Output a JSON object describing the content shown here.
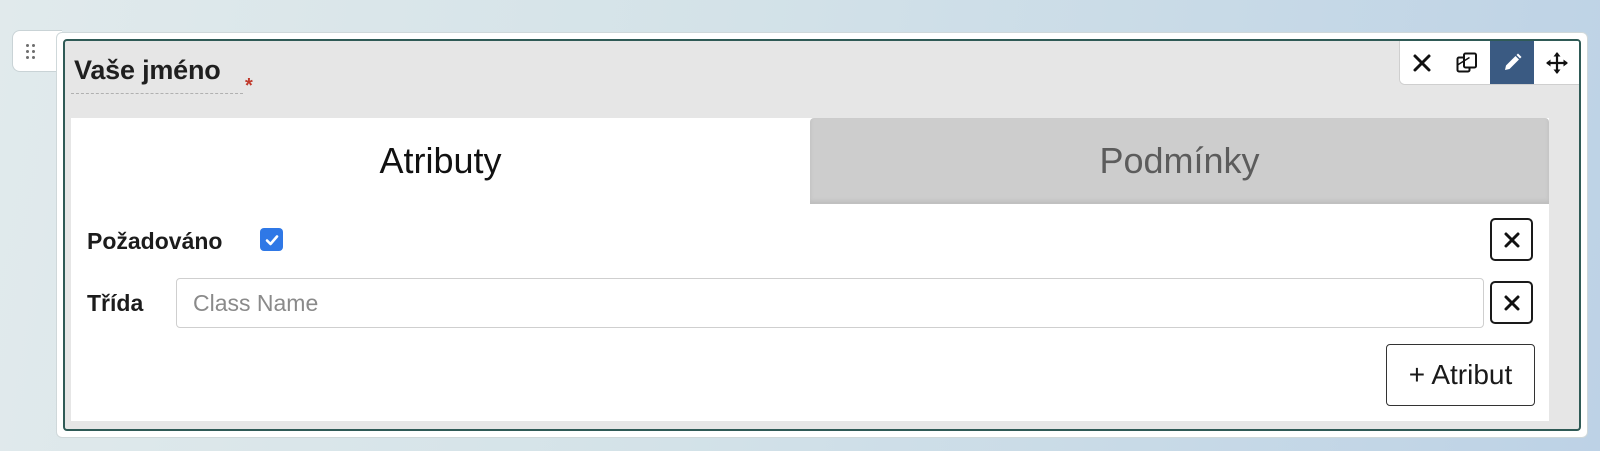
{
  "field": {
    "label": "Vaše jméno",
    "required_marker": "*"
  },
  "toolbar": {
    "buttons": [
      {
        "icon": "close-icon",
        "title": "remove"
      },
      {
        "icon": "copy-icon",
        "title": "copy"
      },
      {
        "icon": "pencil-icon",
        "title": "edit",
        "active": true
      },
      {
        "icon": "move-icon",
        "title": "move"
      }
    ],
    "active_color": "#3a5a82"
  },
  "tabs": [
    {
      "label": "Atributy",
      "active": true
    },
    {
      "label": "Podmínky",
      "active": false
    }
  ],
  "attributes": {
    "required": {
      "label": "Požadováno",
      "checked": true
    },
    "class": {
      "label": "Třída",
      "value": "",
      "placeholder": "Class Name"
    },
    "add_button": "+ Atribut"
  },
  "colors": {
    "accent": "#2f78e6",
    "border_active": "#2f5a56",
    "required_star": "#c0392b"
  }
}
